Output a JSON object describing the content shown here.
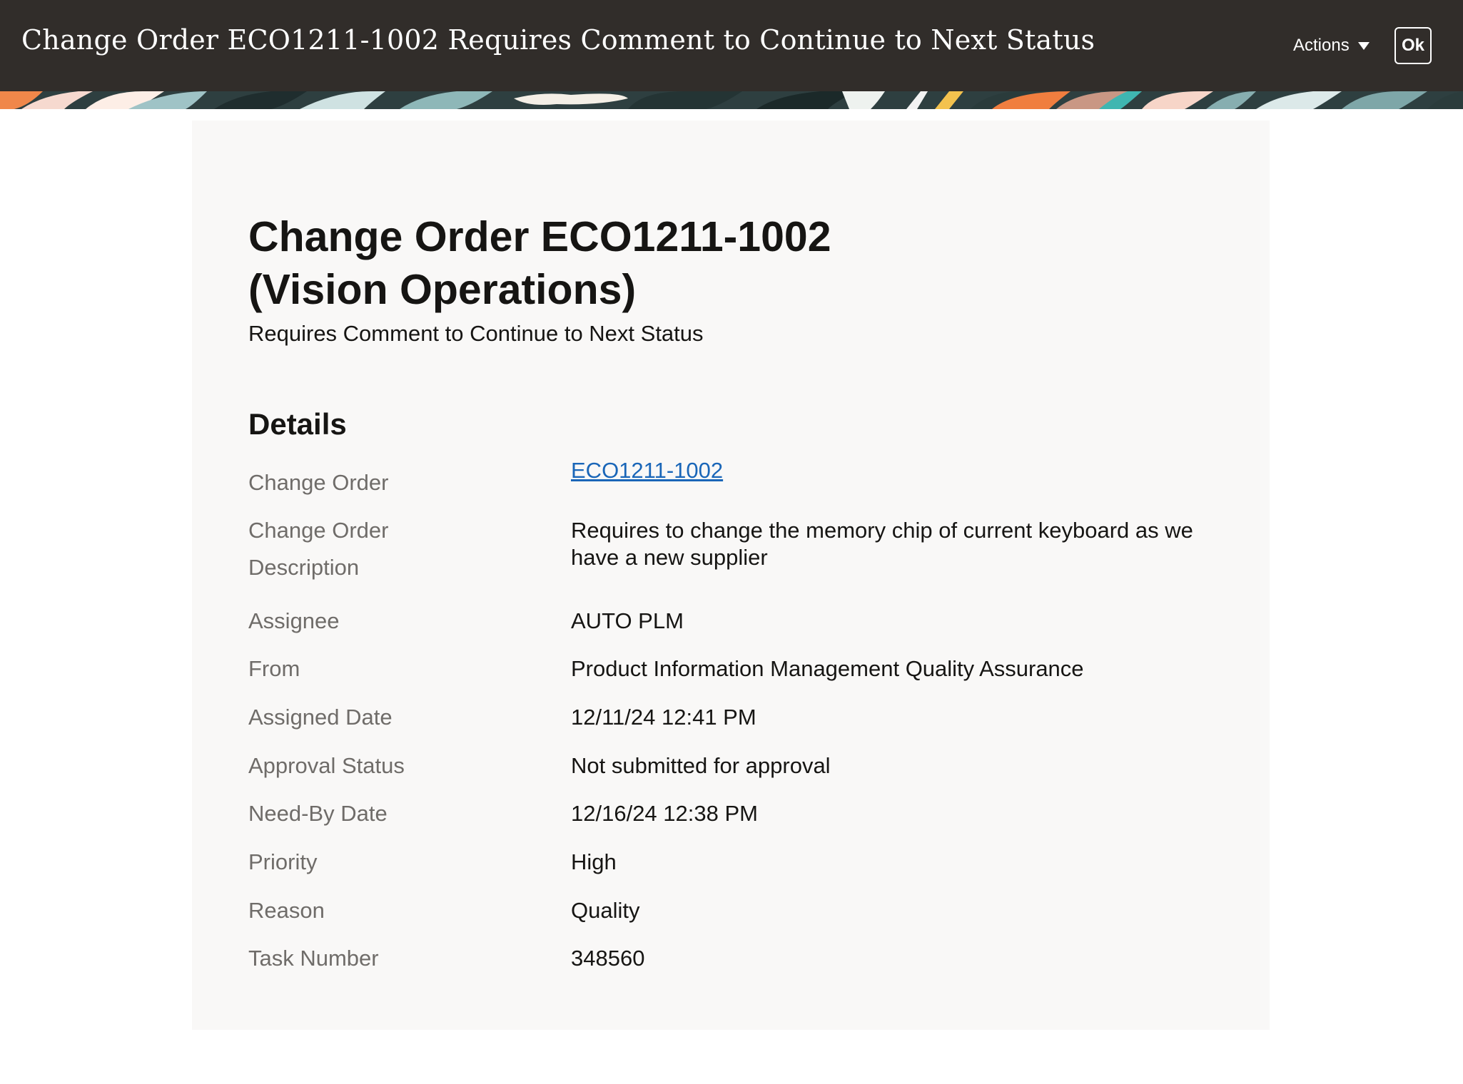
{
  "header": {
    "title": "Change Order ECO1211-1002 Requires Comment to Continue to Next Status",
    "actions_label": "Actions",
    "ok_label": "Ok"
  },
  "card": {
    "title_line1": "Change Order ECO1211-1002",
    "title_line2": "(Vision Operations)",
    "subtitle": "Requires Comment to Continue to Next Status",
    "section_heading": "Details"
  },
  "details": {
    "change_order": {
      "label": "Change Order",
      "value": "ECO1211-1002"
    },
    "description": {
      "label_line1": "Change Order",
      "label_line2": "Description",
      "value": "Requires to change the memory chip of current keyboard as we have a new supplier"
    },
    "assignee": {
      "label": "Assignee",
      "value": "AUTO PLM"
    },
    "from": {
      "label": "From",
      "value": "Product Information Management Quality Assurance"
    },
    "assigned_date": {
      "label": "Assigned Date",
      "value": "12/11/24 12:41 PM"
    },
    "approval_status": {
      "label": "Approval Status",
      "value": "Not submitted for approval"
    },
    "need_by_date": {
      "label": "Need-By Date",
      "value": "12/16/24 12:38 PM"
    },
    "priority": {
      "label": "Priority",
      "value": "High"
    },
    "reason": {
      "label": "Reason",
      "value": "Quality"
    },
    "task_number": {
      "label": "Task Number",
      "value": "348560"
    }
  },
  "colors": {
    "header_bg": "#312d2a",
    "card_bg": "#f9f8f7",
    "link": "#1a66b8",
    "label": "#6f6c69",
    "text": "#161513"
  }
}
